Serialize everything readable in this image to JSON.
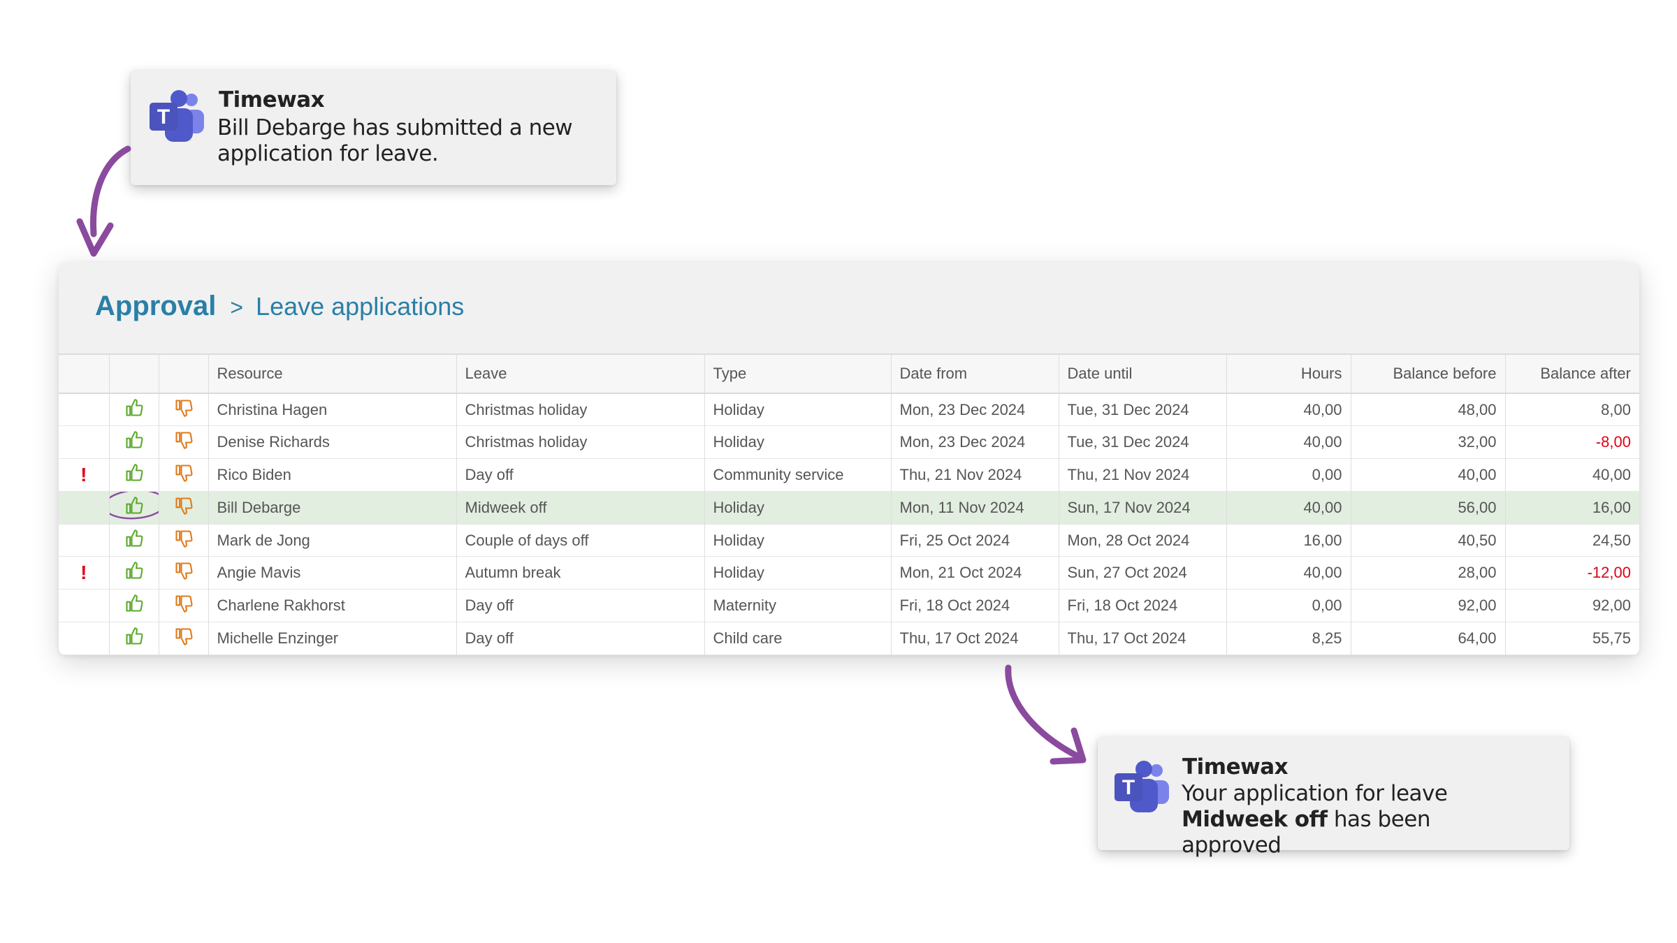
{
  "notification_top": {
    "app": "Timewax",
    "message": "Bill Debarge has submitted a new application for leave."
  },
  "notification_bottom": {
    "app": "Timewax",
    "message_prefix": "Your application for leave ",
    "message_bold": "Midweek off",
    "message_suffix": " has been approved"
  },
  "breadcrumb": {
    "root": "Approval",
    "separator": ">",
    "page": "Leave applications"
  },
  "table": {
    "columns": [
      "Resource",
      "Leave",
      "Type",
      "Date from",
      "Date until",
      "Hours",
      "Balance before",
      "Balance after"
    ],
    "rows": [
      {
        "alert": false,
        "resource": "Christina Hagen",
        "leave": "Christmas holiday",
        "type": "Holiday",
        "date_from": "Mon, 23 Dec 2024",
        "date_until": "Tue, 31 Dec 2024",
        "hours": "40,00",
        "balance_before": "48,00",
        "balance_after": "8,00",
        "negative": false,
        "selected": false
      },
      {
        "alert": false,
        "resource": "Denise Richards",
        "leave": "Christmas holiday",
        "type": "Holiday",
        "date_from": "Mon, 23 Dec 2024",
        "date_until": "Tue, 31 Dec 2024",
        "hours": "40,00",
        "balance_before": "32,00",
        "balance_after": "-8,00",
        "negative": true,
        "selected": false
      },
      {
        "alert": true,
        "resource": "Rico Biden",
        "leave": "Day off",
        "type": "Community service",
        "date_from": "Thu, 21 Nov 2024",
        "date_until": "Thu, 21 Nov 2024",
        "hours": "0,00",
        "balance_before": "40,00",
        "balance_after": "40,00",
        "negative": false,
        "selected": false
      },
      {
        "alert": false,
        "resource": "Bill Debarge",
        "leave": "Midweek off",
        "type": "Holiday",
        "date_from": "Mon, 11 Nov 2024",
        "date_until": "Sun, 17 Nov 2024",
        "hours": "40,00",
        "balance_before": "56,00",
        "balance_after": "16,00",
        "negative": false,
        "selected": true
      },
      {
        "alert": false,
        "resource": "Mark de Jong",
        "leave": "Couple of days off",
        "type": "Holiday",
        "date_from": "Fri, 25 Oct 2024",
        "date_until": "Mon, 28 Oct 2024",
        "hours": "16,00",
        "balance_before": "40,50",
        "balance_after": "24,50",
        "negative": false,
        "selected": false
      },
      {
        "alert": true,
        "resource": "Angie Mavis",
        "leave": "Autumn break",
        "type": "Holiday",
        "date_from": "Mon, 21 Oct 2024",
        "date_until": "Sun, 27 Oct 2024",
        "hours": "40,00",
        "balance_before": "28,00",
        "balance_after": "-12,00",
        "negative": true,
        "selected": false
      },
      {
        "alert": false,
        "resource": "Charlene Rakhorst",
        "leave": "Day off",
        "type": "Maternity",
        "date_from": "Fri, 18 Oct 2024",
        "date_until": "Fri, 18 Oct 2024",
        "hours": "0,00",
        "balance_before": "92,00",
        "balance_after": "92,00",
        "negative": false,
        "selected": false
      },
      {
        "alert": false,
        "resource": "Michelle Enzinger",
        "leave": "Day off",
        "type": "Child care",
        "date_from": "Thu, 17 Oct 2024",
        "date_until": "Thu, 17 Oct 2024",
        "hours": "8,25",
        "balance_before": "64,00",
        "balance_after": "55,75",
        "negative": false,
        "selected": false
      }
    ]
  },
  "icons": {
    "approve": "thumbs-up-icon",
    "reject": "thumbs-down-icon",
    "alert": "exclamation-icon",
    "app": "teams-icon"
  },
  "colors": {
    "accent": "#2a7fa7",
    "approve": "#5aaa2a",
    "reject": "#e07a1a",
    "negative": "#e0001a",
    "arrow": "#8a4a9e",
    "selected_row": "#e2eee0"
  }
}
